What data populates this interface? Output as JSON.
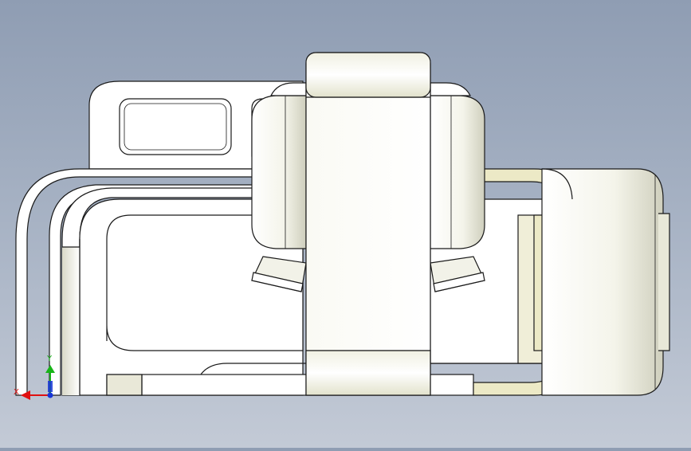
{
  "viewport": {
    "background_top": "#8f9db3",
    "background_bottom": "#c3cad6",
    "part_fill": "#ffffff",
    "part_shade": "#e7e7dc",
    "part_tan": "#ece9c6",
    "edge_color": "#1a1a1a"
  },
  "triad": {
    "x_label": "X",
    "y_label": "Y",
    "x_color": "#e01010",
    "y_color": "#18b418",
    "z_color": "#1836d8"
  }
}
